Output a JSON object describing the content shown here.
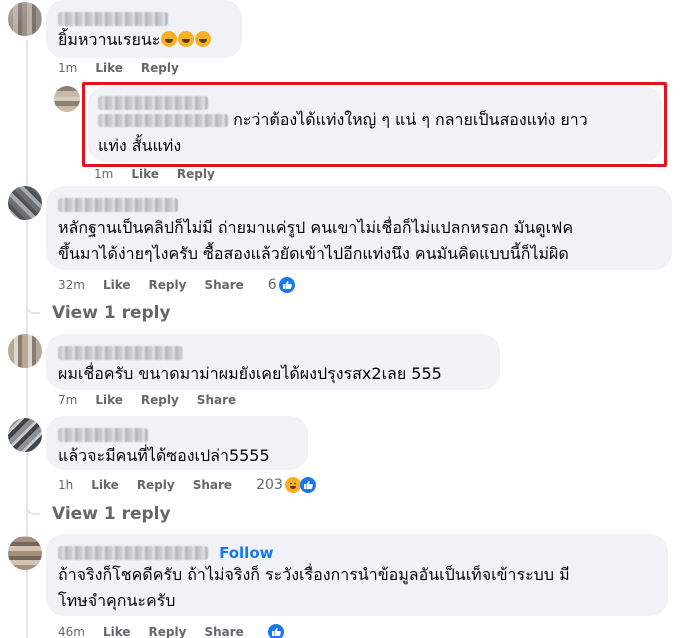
{
  "comments": [
    {
      "id": "c1",
      "text": "ยิ้มหวานเรยนะ",
      "emoji_count": 3,
      "emoji": "rolling-on-floor-laughing",
      "time": "1m",
      "actions": [
        "Like",
        "Reply"
      ]
    },
    {
      "id": "c2",
      "text_line1": "กะว่าต้องได้แท่งใหญ่ ๆ แน่ ๆ กลายเป็นสองแท่ง ยาว",
      "text_line2": "แท่ง สั้นแท่ง",
      "time": "1m",
      "actions": [
        "Like",
        "Reply"
      ]
    },
    {
      "id": "c3",
      "text_line1": "หลักฐานเป็นคลิปก็ไม่มี ถ่ายมาแค่รูป คนเขาไม่เชื่อก็ไม่แปลกหรอก มันดูเฟค",
      "text_line2": "ขึ้นมาได้ง่ายๆไงครับ ซื้อสองแล้วยัดเข้าไปอีกแท่งนึง คนมันคิดแบบนี้ก็ไม่ผิด",
      "time": "32m",
      "actions": [
        "Like",
        "Reply",
        "Share"
      ],
      "reaction_count": "6",
      "view_replies": "View 1 reply"
    },
    {
      "id": "c4",
      "text": "ผมเชื่อครับ ขนาดมาม่าผมยังเคยได้ผงปรุงรสx2เลย 555",
      "time": "7m",
      "actions": [
        "Like",
        "Reply",
        "Share"
      ]
    },
    {
      "id": "c5",
      "text": "แล้วจะมีคนที่ได้ซองเปล่า5555",
      "time": "1h",
      "actions": [
        "Like",
        "Reply",
        "Share"
      ],
      "reaction_count": "203",
      "view_replies": "View 1 reply"
    },
    {
      "id": "c6",
      "follow_label": "Follow",
      "text_line1": "ถ้าจริงก็โชคดีครับ ถ้าไม่จริงก็ ระวังเรื่องการนำข้อมูลอันเป็นเท็จเข้าระบบ มี",
      "text_line2": "โทษจำคุกนะครับ",
      "time": "46m",
      "actions": [
        "Like",
        "Reply",
        "Share"
      ]
    }
  ],
  "colors": {
    "bubble": "#f0f2f5",
    "meta": "#65676b",
    "link_blue": "#1877f2",
    "highlight_red": "#e1141e"
  }
}
